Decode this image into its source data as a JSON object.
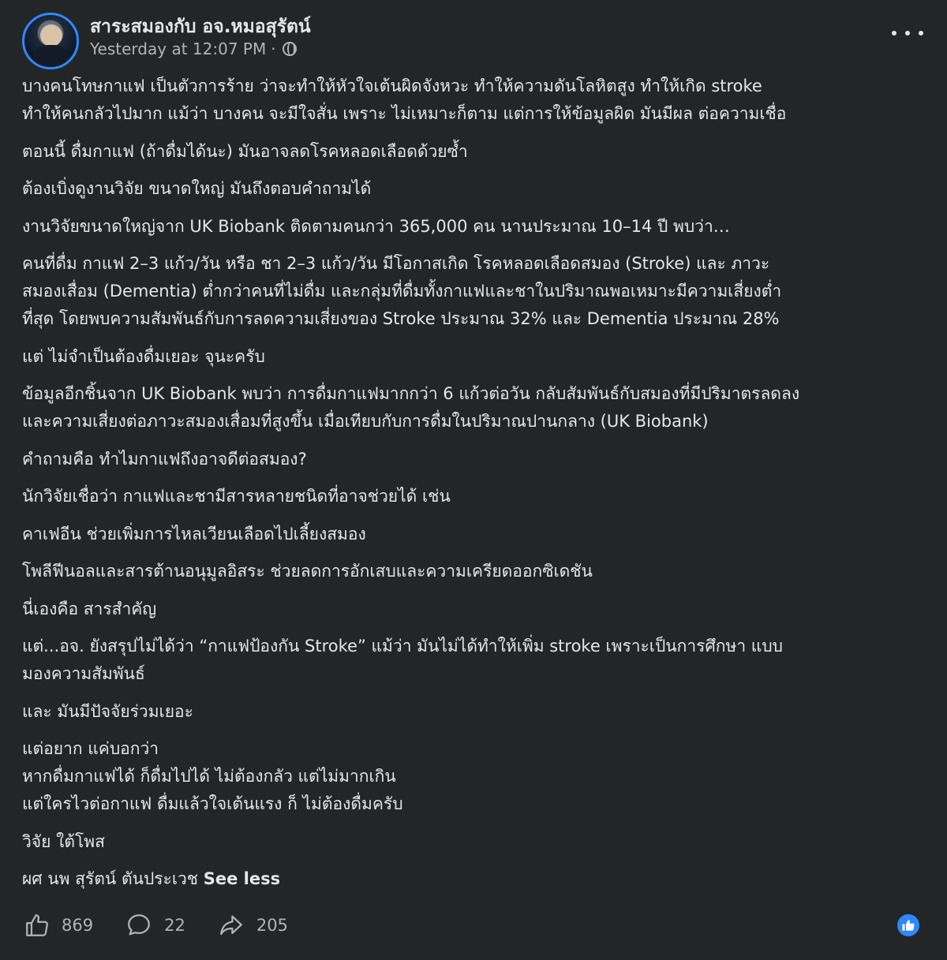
{
  "post": {
    "page_name": "สาระสมองกับ อจ.หมอสุรัตน์",
    "timestamp": "Yesterday at 12:07 PM",
    "separator": "·",
    "privacy_icon": "globe-icon",
    "more_icon": "more-options-icon",
    "paragraphs": [
      [
        "บางคนโทษกาแฟ เป็นตัวการร้าย ว่าจะทำให้หัวใจเต้นผิดจังหวะ ทำให้ความดันโลหิตสูง ทำให้เกิด stroke",
        "ทำให้คนกลัวไปมาก แม้ว่า บางคน จะมีใจสั่น เพราะ ไม่เหมาะก็ตาม แต่การให้ข้อมูลผิด มันมีผล ต่อความเชื่อ"
      ],
      [
        "ตอนนี้ ดื่มกาแฟ (ถ้าดื่มได้นะ) มันอาจลดโรคหลอดเลือดด้วยซ้ำ"
      ],
      [
        "ต้องเบิ่งดูงานวิจัย ขนาดใหญ่ มันถึงตอบคำถามได้"
      ],
      [
        "งานวิจัยขนาดใหญ่จาก UK Biobank ติดตามคนกว่า 365,000 คน นานประมาณ 10–14 ปี พบว่า…"
      ],
      [
        "คนที่ดื่ม กาแฟ 2–3 แก้ว/วัน หรือ ชา 2–3 แก้ว/วัน มีโอกาสเกิด โรคหลอดเลือดสมอง (Stroke) และ ภาวะ",
        "สมองเสื่อม (Dementia) ต่ำกว่าคนที่ไม่ดื่ม และกลุ่มที่ดื่มทั้งกาแฟและชาในปริมาณพอเหมาะมีความเสี่ยงต่ำ",
        "ที่สุด โดยพบความสัมพันธ์กับการลดความเสี่ยงของ Stroke ประมาณ 32% และ Dementia ประมาณ 28%"
      ],
      [
        "แต่ ไม่จำเป็นต้องดื่มเยอะ จุนะครับ"
      ],
      [
        "ข้อมูลอีกชิ้นจาก UK Biobank พบว่า การดื่มกาแฟมากกว่า 6 แก้วต่อวัน กลับสัมพันธ์กับสมองที่มีปริมาตรลดลง",
        "และความเสี่ยงต่อภาวะสมองเสื่อมที่สูงขึ้น เมื่อเทียบกับการดื่มในปริมาณปานกลาง (UK Biobank)"
      ],
      [
        "คำถามคือ ทำไมกาแฟถึงอาจดีต่อสมอง?"
      ],
      [
        "นักวิจัยเชื่อว่า กาแฟและชามีสารหลายชนิดที่อาจช่วยได้ เช่น"
      ],
      [
        "คาเฟอีน ช่วยเพิ่มการไหลเวียนเลือดไปเลี้ยงสมอง"
      ],
      [
        "โพลีฟีนอลและสารต้านอนุมูลอิสระ ช่วยลดการอักเสบและความเครียดออกซิเดชัน"
      ],
      [
        "นี่เองคือ สารสำคัญ"
      ],
      [
        "แต่...อจ. ยังสรุปไม่ได้ว่า “กาแฟป้องกัน Stroke” แม้ว่า มันไม่ได้ทำให้เพิ่ม stroke เพราะเป็นการศึกษา แบบ",
        "มองความสัมพันธ์"
      ],
      [
        "และ มันมีปัจจัยร่วมเยอะ"
      ],
      [
        "แต่อยาก แค่บอกว่า",
        "หากดื่มกาแฟได้ ก็ดื่มไปได้ ไม่ต้องกลัว แต่ไม่มากเกิน",
        "แต่ใครไวต่อกาแฟ ดื่มแล้วใจเต้นแรง ก็ ไม่ต้องดื่มครับ"
      ],
      [
        "วิจัย ใต้โพส"
      ]
    ],
    "signature": "ผศ นพ สุรัตน์ ตันประเวช",
    "see_less": "See less"
  },
  "footer": {
    "likes": "869",
    "comments": "22",
    "shares": "205",
    "like_icon": "thumbs-up-icon",
    "comment_icon": "comment-bubble-icon",
    "share_icon": "share-arrow-icon",
    "accent_color": "#2d88ff"
  }
}
